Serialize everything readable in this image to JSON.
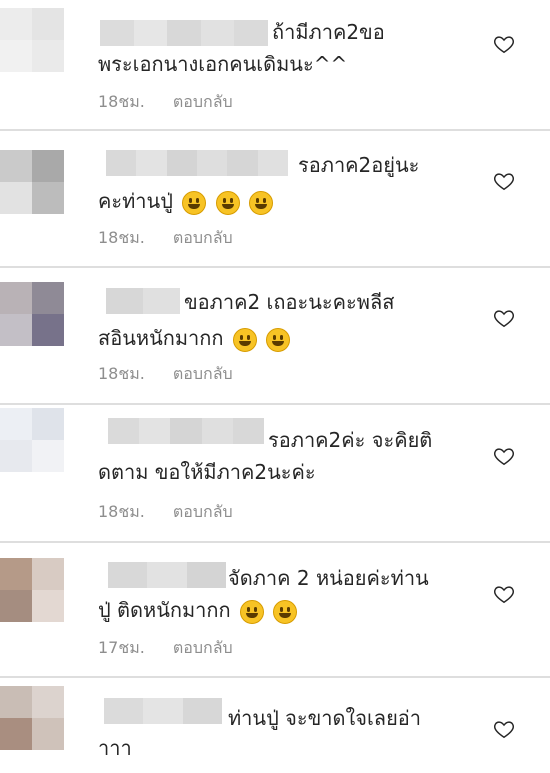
{
  "colors": {
    "text": "#262626",
    "meta": "#8e8e8e",
    "divider": "#dedede",
    "heart": "#262626",
    "emoji": "#f7c325"
  },
  "comments": [
    {
      "line1": "ถ้ามีภาค2ขอ",
      "line2": "พระเอกนางเอกคนเดิมนะ^^",
      "time": "18ชม.",
      "reply": "ตอบกลับ",
      "emojis": []
    },
    {
      "line1": "รอภาค2อยู่นะ",
      "line2": "คะท่านปู่",
      "time": "18ชม.",
      "reply": "ตอบกลับ",
      "emojis": [
        "grinning-face",
        "grinning-face",
        "grinning-face"
      ]
    },
    {
      "line1": "ขอภาค2 เถอะนะคะพลีส",
      "line2": "สอินหนักมากก",
      "time": "18ชม.",
      "reply": "ตอบกลับ",
      "emojis": [
        "tears-of-joy",
        "tears-of-joy"
      ]
    },
    {
      "line1": "รอภาค2ค่ะ จะคิยติ",
      "line2": "ดตาม ขอให้มีภาค2นะค่ะ",
      "time": "18ชม.",
      "reply": "ตอบกลับ",
      "emojis": []
    },
    {
      "line1": "จัดภาค 2 หน่อยค่ะท่าน",
      "line2": "ปู่ ติดหนักมากก",
      "time": "17ชม.",
      "reply": "ตอบกลับ",
      "emojis": [
        "tears-of-joy",
        "tears-of-joy"
      ]
    },
    {
      "line1": "ท่านปู่ จะขาดใจเลยอ่า",
      "line2": "าาา",
      "time": "",
      "reply": "",
      "emojis": []
    }
  ]
}
